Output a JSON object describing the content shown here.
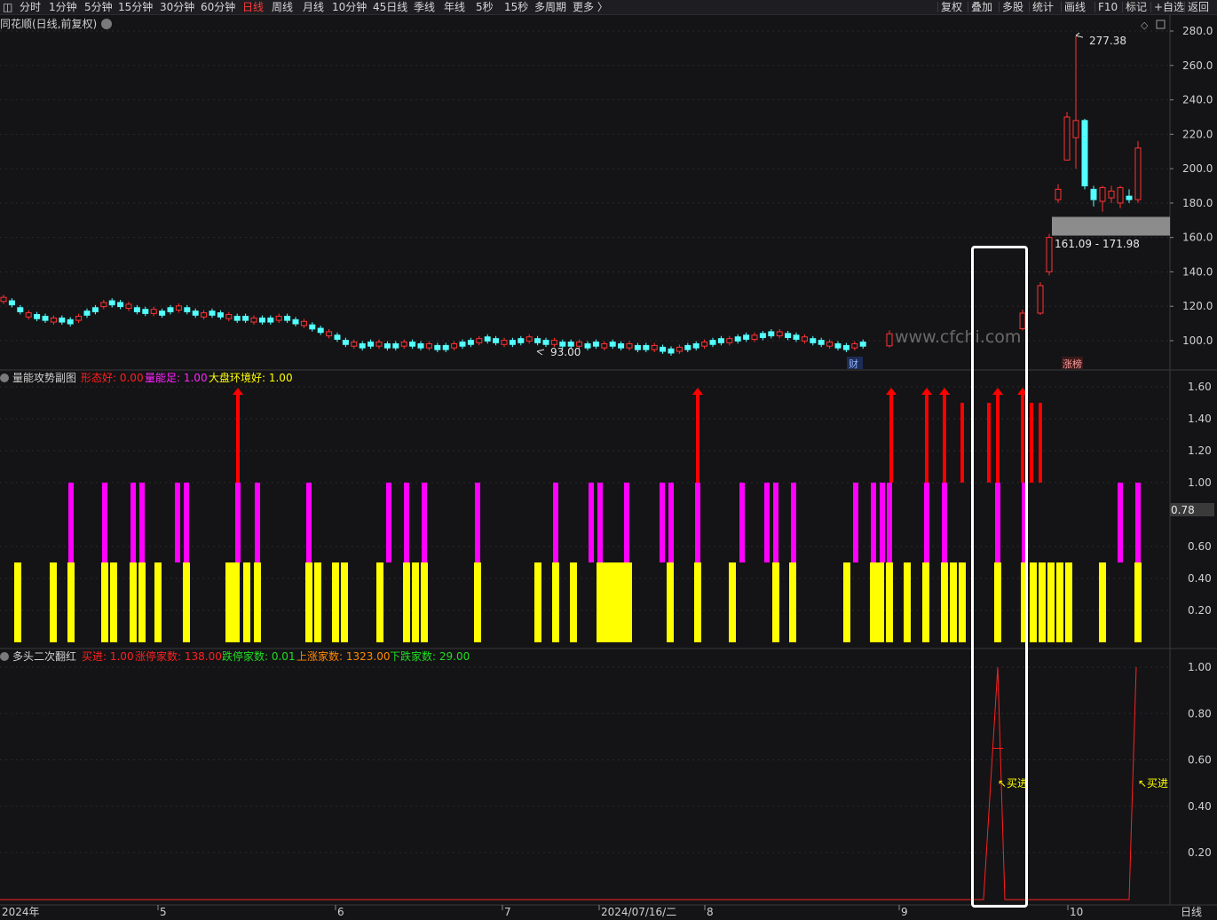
{
  "toolbar": {
    "left_icon": "panel-toggle-icon",
    "periods": [
      "分时",
      "1分钟",
      "5分钟",
      "15分钟",
      "30分钟",
      "60分钟",
      "日线",
      "周线",
      "月线",
      "10分钟",
      "45日线",
      "季线",
      "年线",
      "5秒",
      "15秒",
      "多周期",
      "更多 〉"
    ],
    "active_period": "日线",
    "right_buttons": [
      "复权",
      "叠加",
      "多股",
      "统计",
      "画线",
      "F10",
      "标记",
      "+自选",
      "返回"
    ]
  },
  "main_panel": {
    "title": "同花顺(日线,前复权)",
    "y_ticks": [
      "280.0",
      "260.0",
      "240.0",
      "220.0",
      "200.0",
      "180.0",
      "160.0",
      "140.0",
      "120.0",
      "100.0"
    ],
    "high_label": "277.38",
    "low_label": "93.00",
    "gap_label": "161.09 - 171.98",
    "watermark": "www.cfchi.com",
    "badge_cai": "财",
    "badge_zhangting": "涨榜",
    "colors": {
      "up": "#ff3232",
      "down": "#54ffff",
      "gap": "#8c8c8c"
    }
  },
  "sub_panel_1": {
    "name": "量能攻势副图",
    "legend": [
      {
        "label": "形态好: 0.00",
        "color": "#ff2020"
      },
      {
        "label": "量能足: 1.00",
        "color": "#ff22ff"
      },
      {
        "label": "大盘环境好: 1.00",
        "color": "#ffff00"
      }
    ],
    "y_ticks": [
      "1.60",
      "1.40",
      "1.20",
      "1.00",
      "0.60",
      "0.40",
      "0.20"
    ],
    "current_value": "0.78",
    "colors": {
      "red": "#ff0000",
      "magenta": "#ff00ff",
      "yellow": "#ffff00"
    }
  },
  "sub_panel_2": {
    "name": "多头二次翻红",
    "legend": [
      {
        "label": "买进: 1.00",
        "color": "#ff2020"
      },
      {
        "label": "涨停家数: 138.00",
        "color": "#ff2020"
      },
      {
        "label": "跌停家数: 0.01",
        "color": "#22dd22"
      },
      {
        "label": "上涨家数: 1323.00",
        "color": "#ff8800"
      },
      {
        "label": "下跌家数: 29.00",
        "color": "#22dd22"
      }
    ],
    "y_ticks": [
      "1.00",
      "0.80",
      "0.60",
      "0.40",
      "0.20"
    ],
    "signal_label": "↖买进",
    "signal_color": "#ffff00"
  },
  "x_axis": {
    "labels": [
      "2024年",
      "5",
      "6",
      "7",
      "2024/07/16/二",
      "8",
      "9",
      "10"
    ],
    "right_label": "日线"
  }
}
